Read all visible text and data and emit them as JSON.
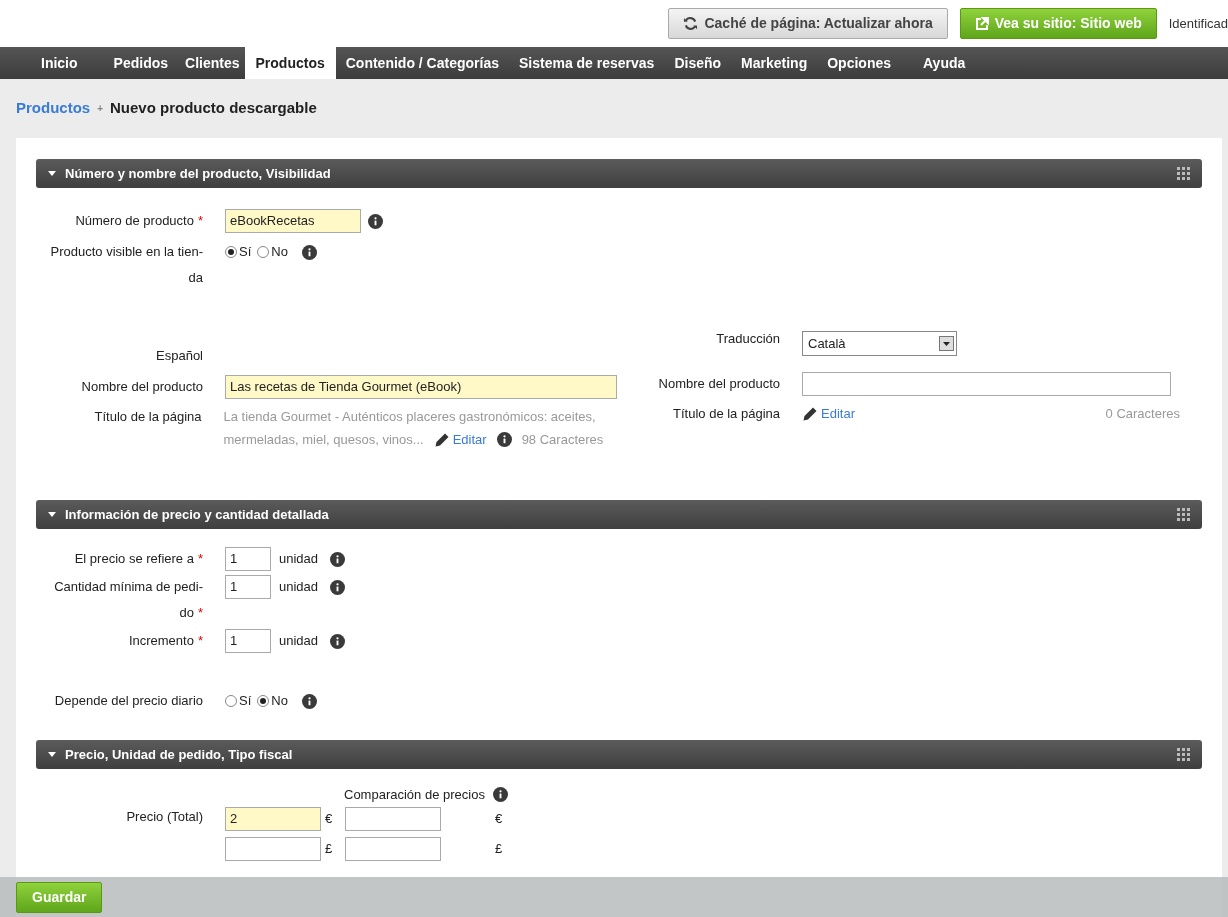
{
  "top_bar": {
    "cache_button": "Caché de página: Actualizar ahora",
    "site_button": "Vea su sitio: Sitio web",
    "user_text": "Identificad"
  },
  "nav": [
    {
      "label": "Inicio",
      "selected": false
    },
    {
      "label": "Pedidos",
      "selected": false
    },
    {
      "label": "Clientes",
      "selected": false
    },
    {
      "label": "Productos",
      "selected": true
    },
    {
      "label": "Contenido / Categorías",
      "selected": false
    },
    {
      "label": "Sistema de reservas",
      "selected": false
    },
    {
      "label": "Diseño",
      "selected": false
    },
    {
      "label": "Marketing",
      "selected": false
    },
    {
      "label": "Opciones",
      "selected": false
    },
    {
      "label": "Ayuda",
      "selected": false
    }
  ],
  "breadcrumb": {
    "link": "Productos",
    "separator": "+",
    "current": "Nuevo producto descargable"
  },
  "section_1": {
    "title": "Número y nombre del producto, Visibilidad",
    "rows": [
      {
        "kind": "input",
        "label": [
          "Número de producto"
        ],
        "required": true,
        "value": "eBookRecetas",
        "highlighted": true
      },
      {
        "kind": "radio",
        "label": [
          "Producto visible en la tien-",
          "da"
        ],
        "required": false,
        "options": [
          {
            "label": "Sí",
            "selected": true
          },
          {
            "label": "No",
            "selected": false
          }
        ]
      }
    ],
    "left": {
      "language": "Español",
      "name_label": "Nombre del producto",
      "name_value": "Las recetas de Tienda Gourmet (eBook)",
      "title_label": "Título de la página",
      "title_lines": [
        "La tienda Gourmet - Auténticos placeres gastronómicos: aceites,",
        "mermeladas, miel, quesos, vinos..."
      ],
      "edit_link": "Editar",
      "count": "98 Caracteres"
    },
    "right": {
      "translation_label": "Traducción",
      "translation_value": "Català",
      "name_label": "Nombre del producto",
      "title_label": "Título de la página",
      "edit_link": "Editar",
      "count": "0 Caracteres"
    }
  },
  "section_2": {
    "title": "Información de precio y cantidad detallada",
    "rows": [
      {
        "kind": "unit",
        "label": [
          "El precio se refiere a"
        ],
        "required": true,
        "value": "1",
        "unit": "unidad"
      },
      {
        "kind": "unit",
        "label": [
          "Cantidad mínima de pedi-",
          "do"
        ],
        "required": true,
        "value": "1",
        "unit": "unidad"
      },
      {
        "kind": "unit",
        "label": [
          "Incremento"
        ],
        "required": true,
        "value": "1",
        "unit": "unidad"
      },
      {
        "kind": "radio",
        "label": [
          "Depende del precio diario"
        ],
        "required": false,
        "options": [
          {
            "label": "Sí",
            "selected": false
          },
          {
            "label": "No",
            "selected": true
          }
        ]
      }
    ]
  },
  "section_3": {
    "title": "Precio, Unidad de pedido, Tipo fiscal",
    "comparison_label": "Comparación de precios",
    "price_label": "Precio (Total)",
    "price_rows": [
      {
        "value": "2",
        "currency": "€",
        "compare_currency": "€"
      },
      {
        "value": "",
        "currency": "£",
        "compare_currency": "£"
      }
    ]
  },
  "required_mark": "*",
  "save_button": "Guardar"
}
